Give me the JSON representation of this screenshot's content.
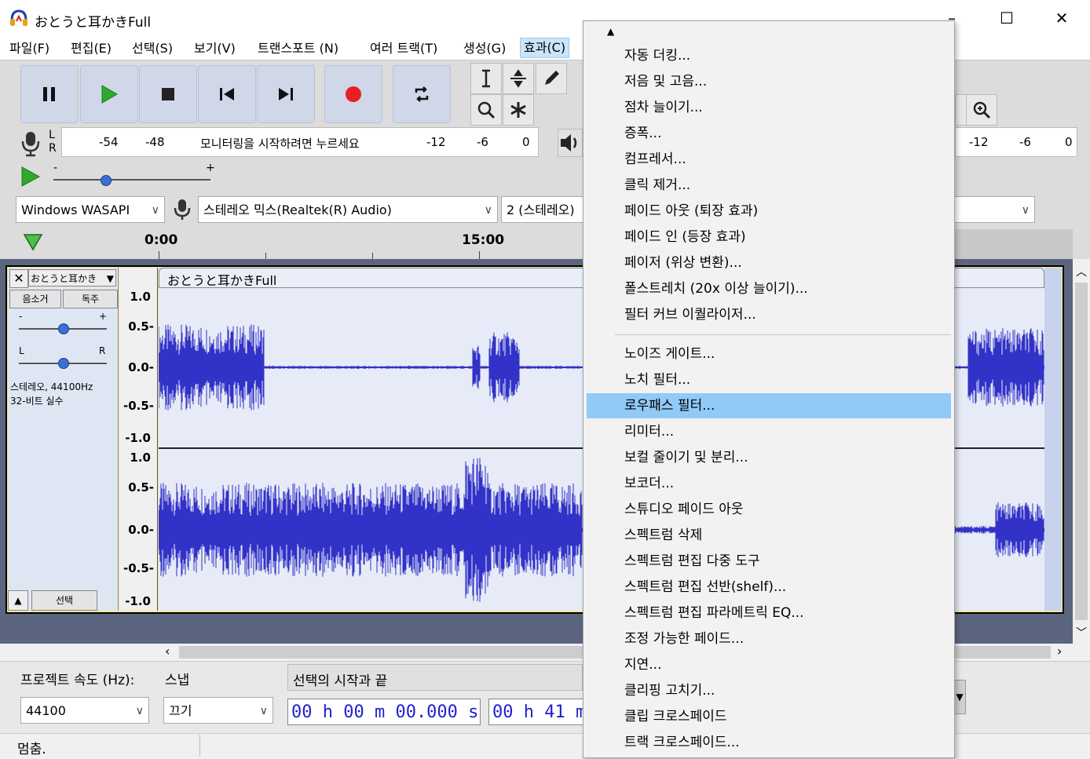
{
  "window": {
    "title": "おとうと耳かきFull",
    "minimize": "–",
    "maximize": "☐",
    "close": "✕"
  },
  "menubar": {
    "file": "파일(F)",
    "edit": "편집(E)",
    "select": "선택(S)",
    "view": "보기(V)",
    "transport": "트랜스포트 (N)",
    "tracks": "여러 트랙(T)",
    "generate": "생성(G)",
    "effects": "효과(C)"
  },
  "meters": {
    "record_ticks_left": [
      "-54",
      "-48"
    ],
    "record_ticks_right": [
      "-12",
      "-6",
      "0"
    ],
    "monitor_prompt": "모니터링을 시작하려면 누르세요",
    "play_ticks_right": [
      "-12",
      "-6",
      "0"
    ],
    "channel_l": "L",
    "channel_r": "R"
  },
  "playback_speed": {
    "minus": "-",
    "plus": "+"
  },
  "device": {
    "host": "Windows WASAPI",
    "input": "스테레오 믹스(Realtek(R) Audio)",
    "channels": "2 (스테레오)"
  },
  "timeline": {
    "labels": [
      "0:00",
      "15:00"
    ]
  },
  "track": {
    "name": "おとうと耳かき",
    "clip_name": "おとうと耳かきFull",
    "mute": "음소거",
    "solo": "독주",
    "gain_minus": "-",
    "gain_plus": "+",
    "pan_l": "L",
    "pan_r": "R",
    "info_line1": "스테레오, 44100Hz",
    "info_line2": "32-비트 실수",
    "select": "선택",
    "ruler": [
      "1.0",
      "0.5-",
      "0.0-",
      "-0.5-",
      "-1.0"
    ]
  },
  "bottom": {
    "rate_label": "프로젝트 속도 (Hz):",
    "snap_label": "스냅",
    "selection_label": "선택의 시작과 끝",
    "rate_value": "44100",
    "snap_value": "끄기",
    "time_start": "00 h 00 m 00.000 s",
    "time_end": "00 h 41 m"
  },
  "status": {
    "text": "멈춤."
  },
  "effects_menu": {
    "group1": [
      "자동 더킹...",
      "저음 및 고음...",
      "점차 늘이기...",
      "증폭...",
      "컴프레서...",
      "클릭 제거...",
      "페이드 아웃 (퇴장 효과)",
      "페이드 인 (등장 효과)",
      "페이저 (위상 변환)...",
      "폴스트레치 (20x 이상 늘이기)...",
      "필터 커브 이퀄라이저..."
    ],
    "group2": [
      "노이즈 게이트...",
      "노치 필터...",
      "로우패스 필터...",
      "리미터...",
      "보컬 줄이기 및 분리...",
      "보코더...",
      "스튜디오 페이드 아웃",
      "스펙트럼 삭제",
      "스펙트럼 편집 다중 도구",
      "스펙트럼 편집 선반(shelf)...",
      "스펙트럼 편집 파라메트릭 EQ...",
      "조정 가능한 페이드...",
      "지연...",
      "클리핑 고치기...",
      "클립 크로스페이드",
      "트랙 크로스페이드..."
    ],
    "highlighted": "로우패스 필터..."
  },
  "colors": {
    "waveform": "#3232c8",
    "menu_highlight": "#91c9f7",
    "track_border": "#f4e8a0",
    "record_red": "#e82020",
    "play_green": "#2eaa2e"
  }
}
